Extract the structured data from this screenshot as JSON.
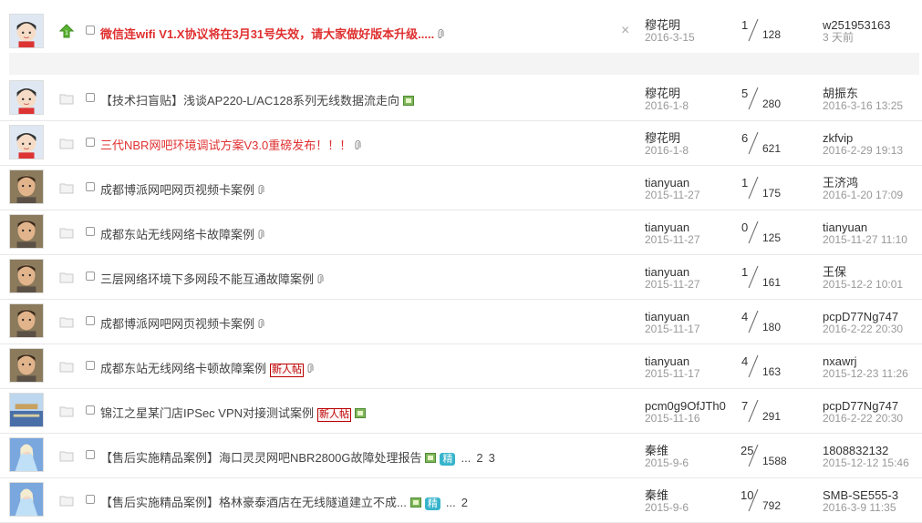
{
  "sticky": {
    "title": "微信连wifi V1.X协议将在3月31号失效，请大家做好版本升级.....",
    "author": "穆花明",
    "date": "2016-3-15",
    "replies": "1",
    "views": "128",
    "last_user": "w251953163",
    "last_time": "3 天前",
    "close_label": "×",
    "folder_badge": "1"
  },
  "threads": [
    {
      "title": "【技术扫盲贴】浅谈AP220-L/AC128系列无线数据流走向",
      "red": false,
      "author": "穆花明",
      "date": "2016-1-8",
      "replies": "5",
      "views": "280",
      "last_user": "胡振东",
      "last_time": "2016-3-16 13:25"
    },
    {
      "title": "三代NBR网吧环境调试方案V3.0重磅发布！！！",
      "red": true,
      "author": "穆花明",
      "date": "2016-1-8",
      "replies": "6",
      "views": "621",
      "last_user": "zkfvip",
      "last_time": "2016-2-29 19:13"
    },
    {
      "title": "成都博派网吧网页视频卡案例",
      "red": false,
      "author": "tianyuan",
      "date": "2015-11-27",
      "replies": "1",
      "views": "175",
      "last_user": "王济鸿",
      "last_time": "2016-1-20 17:09"
    },
    {
      "title": "成都东站无线网络卡故障案例",
      "red": false,
      "author": "tianyuan",
      "date": "2015-11-27",
      "replies": "0",
      "views": "125",
      "last_user": "tianyuan",
      "last_time": "2015-11-27 11:10"
    },
    {
      "title": "三层网络环境下多网段不能互通故障案例",
      "red": false,
      "author": "tianyuan",
      "date": "2015-11-27",
      "replies": "1",
      "views": "161",
      "last_user": "王保",
      "last_time": "2015-12-2 10:01"
    },
    {
      "title": "成都博派网吧网页视频卡案例",
      "red": false,
      "author": "tianyuan",
      "date": "2015-11-17",
      "replies": "4",
      "views": "180",
      "last_user": "pcpD77Ng747",
      "last_time": "2016-2-22 20:30"
    },
    {
      "title": "成都东站无线网络卡顿故障案例",
      "red": false,
      "author": "tianyuan",
      "date": "2015-11-17",
      "replies": "4",
      "views": "163",
      "last_user": "nxawrj",
      "last_time": "2015-12-23 11:26",
      "badge": "新人帖"
    },
    {
      "title": "锦江之星某门店IPSec VPN对接测试案例",
      "red": false,
      "author": "pcm0g9OfJTh0",
      "date": "2015-11-16",
      "replies": "7",
      "views": "291",
      "last_user": "pcpD77Ng747",
      "last_time": "2016-2-22 20:30",
      "badge": "新人帖"
    },
    {
      "title": "【售后实施精品案例】海口灵灵网吧NBR2800G故障处理报告",
      "red": false,
      "author": "秦维",
      "date": "2015-9-6",
      "replies": "25",
      "views": "1588",
      "last_user": "1808832132",
      "last_time": "2015-12-12 15:46",
      "jing": "精",
      "ellipsis": "...",
      "pages": [
        "2",
        "3"
      ]
    },
    {
      "title": "【售后实施精品案例】格林豪泰酒店在无线隧道建立不成...",
      "red": false,
      "author": "秦维",
      "date": "2015-9-6",
      "replies": "10",
      "views": "792",
      "last_user": "SMB-SE555-3",
      "last_time": "2016-3-9 11:35",
      "jing": "精",
      "ellipsis": "...",
      "pages": [
        "2"
      ]
    }
  ]
}
